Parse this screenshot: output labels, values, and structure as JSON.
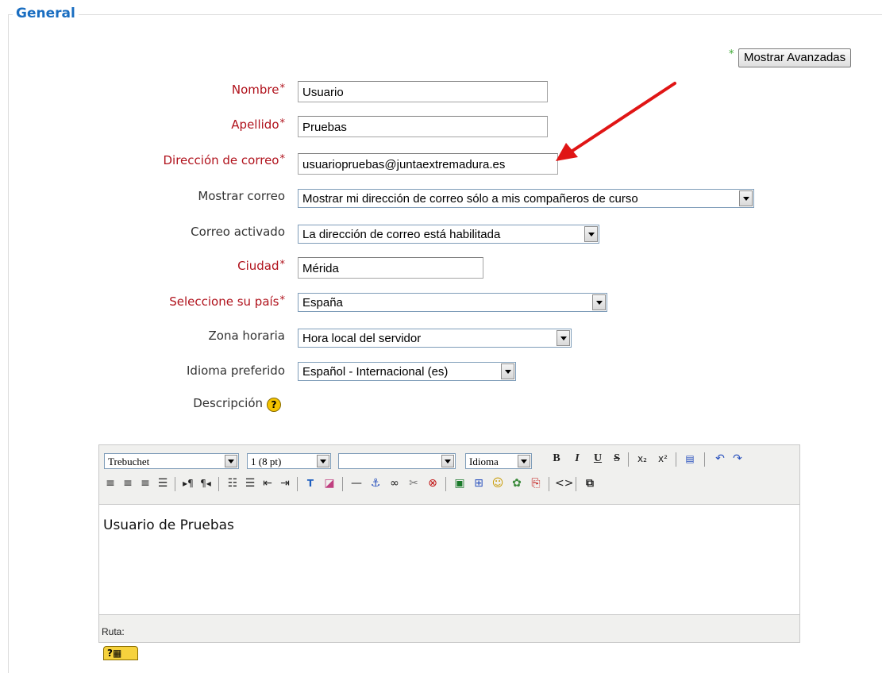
{
  "form": {
    "legend": "General",
    "advanced_button": "Mostrar Avanzadas",
    "fields": {
      "nombre": {
        "label": "Nombre",
        "value": "Usuario"
      },
      "apellido": {
        "label": "Apellido",
        "value": "Pruebas"
      },
      "correo": {
        "label": "Dirección de correo",
        "value": "usuariopruebas@juntaextremadura.es"
      },
      "mostrar_correo": {
        "label": "Mostrar correo",
        "value": "Mostrar mi dirección de correo sólo a mis compañeros de curso"
      },
      "correo_activado": {
        "label": "Correo activado",
        "value": "La dirección de correo está habilitada"
      },
      "ciudad": {
        "label": "Ciudad",
        "value": "Mérida"
      },
      "pais": {
        "label": "Seleccione su país",
        "value": "España"
      },
      "zona": {
        "label": "Zona horaria",
        "value": "Hora local del servidor"
      },
      "idioma": {
        "label": "Idioma preferido",
        "value": "Español - Internacional (es)"
      },
      "descripcion": {
        "label": "Descripción"
      }
    },
    "required_mark": "*"
  },
  "editor": {
    "font_family": "Trebuchet",
    "font_size": "1 (8 pt)",
    "format": "",
    "language": "Idioma",
    "content": "Usuario de Pruebas",
    "path_label": "Ruta:"
  },
  "colors": {
    "legend": "#1a6ec1",
    "required_label": "#b0121c",
    "annotation_arrow": "#e01515"
  }
}
